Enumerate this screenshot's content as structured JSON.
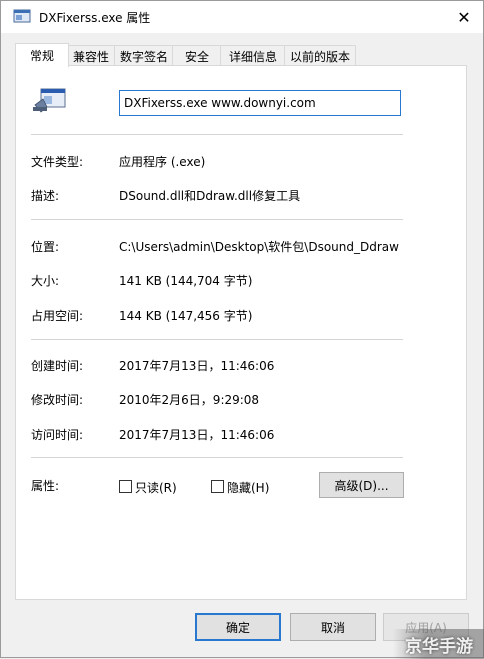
{
  "window": {
    "title": "DXFixerss.exe 属性",
    "close_glyph": "✕"
  },
  "tabs": [
    {
      "label": "常规",
      "active": true
    },
    {
      "label": "兼容性",
      "active": false
    },
    {
      "label": "数字签名",
      "active": false
    },
    {
      "label": "安全",
      "active": false
    },
    {
      "label": "详细信息",
      "active": false
    },
    {
      "label": "以前的版本",
      "active": false
    }
  ],
  "file": {
    "name": "DXFixerss.exe www.downyi.com"
  },
  "general": {
    "type_label": "文件类型:",
    "type_value": "应用程序 (.exe)",
    "desc_label": "描述:",
    "desc_value": "DSound.dll和Ddraw.dll修复工具",
    "location_label": "位置:",
    "location_value": "C:\\Users\\admin\\Desktop\\软件包\\Dsound_Ddraw",
    "size_label": "大小:",
    "size_value": "141 KB (144,704 字节)",
    "disk_label": "占用空间:",
    "disk_value": "144 KB (147,456 字节)",
    "created_label": "创建时间:",
    "created_value": "2017年7月13日，11:46:06",
    "modified_label": "修改时间:",
    "modified_value": "2010年2月6日，9:29:08",
    "accessed_label": "访问时间:",
    "accessed_value": "2017年7月13日，11:46:06",
    "attr_label": "属性:",
    "readonly_label": "只读(R)",
    "readonly_checked": false,
    "hidden_label": "隐藏(H)",
    "hidden_checked": false,
    "advanced_label": "高级(D)..."
  },
  "buttons": {
    "ok": "确定",
    "cancel": "取消",
    "apply": "应用(A)"
  },
  "watermark": {
    "text": "京华手游"
  },
  "colors": {
    "accent": "#2878d0",
    "panel": "#ffffff",
    "window": "#f0f0f0"
  }
}
